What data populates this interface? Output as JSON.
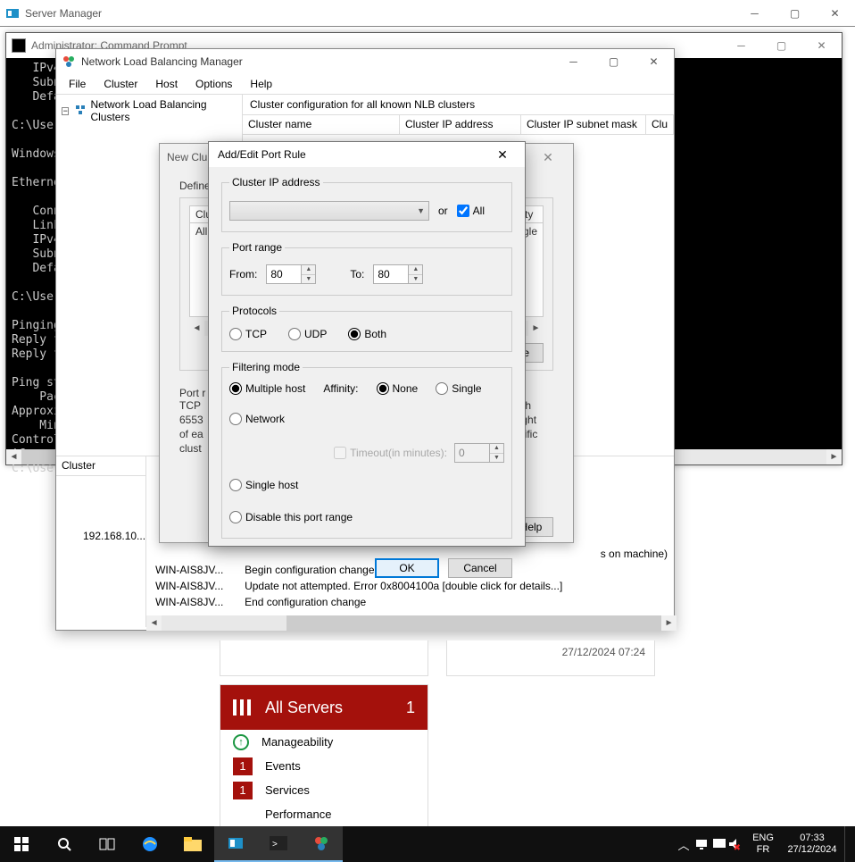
{
  "server_manager": {
    "title": "Server Manager"
  },
  "cmd": {
    "title": "Administrator: Command Prompt",
    "body": "   IPv4\n   Subn\n   Defa\n\nC:\\Users\n\nWindows\n\nEtherne\n\n   Conn\n   Link\n   IPv4\n   Subn\n   Defa\n\nC:\\Users\n\nPinging\nReply f\nReply f\n\nPing st\n    Pac\nApproxi\n    Min\nControl\n^C\nC:\\Users"
  },
  "nlb": {
    "title": "Network Load Balancing Manager",
    "menu": [
      "File",
      "Cluster",
      "Host",
      "Options",
      "Help"
    ],
    "tree_root": "Network Load Balancing Clusters",
    "right_header": "Cluster configuration for all known NLB clusters",
    "grid_cols": [
      "Cluster name",
      "Cluster IP address",
      "Cluster IP subnet mask",
      "Clu"
    ],
    "log_left_header": "Cluster",
    "log_cluster": "192.168.10...",
    "log_rows": [
      {
        "host": "WIN-AIS8JV...",
        "msg": "Begin configuration change"
      },
      {
        "host": "WIN-AIS8JV...",
        "msg": "Update not attempted. Error 0x8004100a [double click for details...]"
      },
      {
        "host": "WIN-AIS8JV...",
        "msg": "End configuration change"
      }
    ],
    "log_extra_msg1": "s on machine)"
  },
  "newcluster": {
    "title": "New Clu",
    "defined_label": "Define",
    "cols": {
      "c1": "Cluste",
      "aff": "inity"
    },
    "row_all": "All",
    "row_ngle": "ngle",
    "remove_btn": "nove",
    "help_btn": "Help",
    "desc_label": "Port r",
    "desc": [
      "TCP",
      "6553",
      "of ea",
      "clust"
    ],
    "desc_right": [
      "ugh",
      "eight",
      "ecific"
    ]
  },
  "portrule": {
    "title": "Add/Edit Port Rule",
    "ip_legend": "Cluster IP address",
    "or": "or",
    "all": "All",
    "range_legend": "Port range",
    "from": "From:",
    "to": "To:",
    "from_val": "80",
    "to_val": "80",
    "proto_legend": "Protocols",
    "tcp": "TCP",
    "udp": "UDP",
    "both": "Both",
    "filter_legend": "Filtering mode",
    "multi": "Multiple host",
    "affinity_lbl": "Affinity:",
    "aff_none": "None",
    "aff_single": "Single",
    "aff_network": "Network",
    "timeout_lbl": "Timeout(in minutes):",
    "timeout_val": "0",
    "single_host": "Single host",
    "disable_range": "Disable this port range",
    "ok": "OK",
    "cancel": "Cancel"
  },
  "dash": {
    "time": "27/12/2024 07:24",
    "all_servers": "All Servers",
    "count": "1",
    "rows": [
      "Manageability",
      "Events",
      "Services",
      "Performance"
    ],
    "badges": [
      "",
      "1",
      "1",
      ""
    ]
  },
  "taskbar": {
    "lang1": "ENG",
    "lang2": "FR",
    "time": "07:33",
    "date": "27/12/2024"
  }
}
